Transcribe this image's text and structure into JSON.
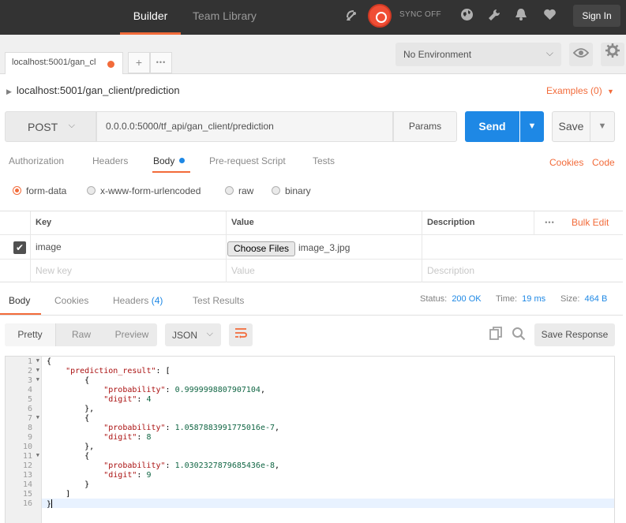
{
  "topbar": {
    "nav": [
      "Builder",
      "Team Library"
    ],
    "sync_label": "SYNC OFF",
    "signin_label": "Sign In",
    "icons": [
      "satellite-icon",
      "sync-icon",
      "globe-icon",
      "wrench-icon",
      "bell-icon",
      "heart-icon"
    ]
  },
  "tabs": {
    "active_tab_label": "localhost:5001/gan_cl",
    "add_label": "+",
    "more_label": "•••"
  },
  "environment": {
    "selected": "No Environment",
    "chevron": "⌵"
  },
  "request": {
    "breadcrumb": "localhost:5001/gan_client/prediction",
    "examples_label": "Examples (0)",
    "method": "POST",
    "url": "0.0.0.0:5000/tf_api/gan_client/prediction",
    "params_label": "Params",
    "send_label": "Send",
    "save_label": "Save"
  },
  "request_tabs": [
    "Authorization",
    "Headers",
    "Body",
    "Pre-request Script",
    "Tests"
  ],
  "request_links": [
    "Cookies",
    "Code"
  ],
  "body_types": [
    "form-data",
    "x-www-form-urlencoded",
    "raw",
    "binary"
  ],
  "form_table": {
    "headers": [
      "Key",
      "Value",
      "Description"
    ],
    "bulk_edit": "Bulk Edit",
    "rows": [
      {
        "key": "image",
        "file_button": "Choose Files",
        "file_name": "image_3.jpg"
      }
    ],
    "placeholder": {
      "key": "New key",
      "value": "Value",
      "description": "Description"
    }
  },
  "response": {
    "tabs": [
      "Body",
      "Cookies",
      "Headers",
      "Test Results"
    ],
    "headers_count": "(4)",
    "status_label": "Status:",
    "status": "200 OK",
    "time_label": "Time:",
    "time": "19 ms",
    "size_label": "Size:",
    "size": "464 B",
    "view_modes": [
      "Pretty",
      "Raw",
      "Preview"
    ],
    "format": "JSON",
    "save_response_label": "Save Response"
  },
  "code": {
    "line_numbers": [
      "1",
      "2",
      "3",
      "4",
      "5",
      "6",
      "7",
      "8",
      "9",
      "10",
      "11",
      "12",
      "13",
      "14",
      "15",
      "16"
    ],
    "lines": [
      {
        "pre": "{",
        "key": "",
        "mid": "",
        "val": "",
        "post": ""
      },
      {
        "pre": "    ",
        "key": "\"prediction_result\"",
        "mid": ": [",
        "val": "",
        "post": ""
      },
      {
        "pre": "        {",
        "key": "",
        "mid": "",
        "val": "",
        "post": ""
      },
      {
        "pre": "            ",
        "key": "\"probability\"",
        "mid": ": ",
        "val": "0.9999998807907104",
        "post": ","
      },
      {
        "pre": "            ",
        "key": "\"digit\"",
        "mid": ": ",
        "val": "4",
        "post": ""
      },
      {
        "pre": "        },",
        "key": "",
        "mid": "",
        "val": "",
        "post": ""
      },
      {
        "pre": "        {",
        "key": "",
        "mid": "",
        "val": "",
        "post": ""
      },
      {
        "pre": "            ",
        "key": "\"probability\"",
        "mid": ": ",
        "val": "1.0587883991775016e-7",
        "post": ","
      },
      {
        "pre": "            ",
        "key": "\"digit\"",
        "mid": ": ",
        "val": "8",
        "post": ""
      },
      {
        "pre": "        },",
        "key": "",
        "mid": "",
        "val": "",
        "post": ""
      },
      {
        "pre": "        {",
        "key": "",
        "mid": "",
        "val": "",
        "post": ""
      },
      {
        "pre": "            ",
        "key": "\"probability\"",
        "mid": ": ",
        "val": "1.0302327879685436e-8",
        "post": ","
      },
      {
        "pre": "            ",
        "key": "\"digit\"",
        "mid": ": ",
        "val": "9",
        "post": ""
      },
      {
        "pre": "        }",
        "key": "",
        "mid": "",
        "val": "",
        "post": ""
      },
      {
        "pre": "    ]",
        "key": "",
        "mid": "",
        "val": "",
        "post": ""
      },
      {
        "pre": "}",
        "key": "",
        "mid": "",
        "val": "",
        "post": ""
      }
    ]
  },
  "colors": {
    "accent": "#f26b3a",
    "primary": "#1e88e5",
    "topbar": "#333333"
  }
}
